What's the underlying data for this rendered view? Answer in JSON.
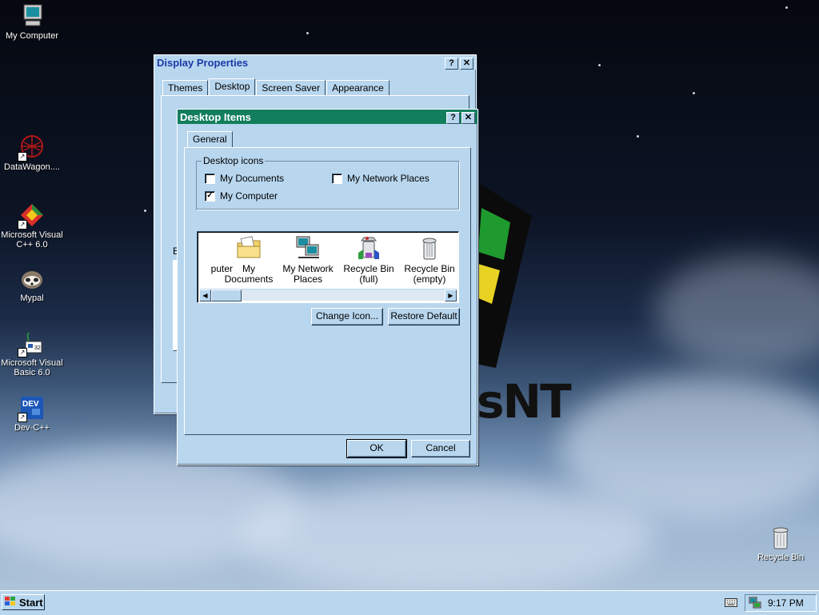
{
  "desktop": {
    "icons": [
      {
        "label": "My Computer",
        "icon": "my-computer-icon"
      },
      {
        "label": "DataWagon....",
        "icon": "datawagon-icon"
      },
      {
        "label": "Microsoft Visual C++ 6.0",
        "icon": "visual-cpp-icon"
      },
      {
        "label": "Mypal",
        "icon": "mypal-icon"
      },
      {
        "label": "Microsoft Visual Basic 6.0",
        "icon": "visual-basic-icon"
      },
      {
        "label": "Dev-C++",
        "icon": "devcpp-icon"
      },
      {
        "label": "Recycle Bin",
        "icon": "recycle-bin-icon"
      }
    ],
    "logo_text": "sNT"
  },
  "display_properties": {
    "title": "Display Properties",
    "help_glyph": "?",
    "close_glyph": "✕",
    "tabs": [
      "Themes",
      "Desktop",
      "Screen Saver",
      "Appearance"
    ],
    "active_tab": "Desktop",
    "partial_label": "B"
  },
  "desktop_items": {
    "title": "Desktop Items",
    "help_glyph": "?",
    "close_glyph": "✕",
    "tab": "General",
    "group_label": "Desktop icons",
    "checkboxes": [
      {
        "label": "My Documents",
        "checked": false
      },
      {
        "label": "My Network Places",
        "checked": false
      },
      {
        "label": "My Computer",
        "checked": true
      }
    ],
    "check_glyph": "✓",
    "list_items": [
      {
        "label": "puter",
        "icon": "my-computer-icon"
      },
      {
        "label": "My Documents",
        "icon": "my-documents-icon"
      },
      {
        "label": "My Network Places",
        "icon": "my-network-places-icon"
      },
      {
        "label": "Recycle Bin (full)",
        "icon": "recycle-bin-full-icon"
      },
      {
        "label": "Recycle Bin (empty)",
        "icon": "recycle-bin-empty-icon"
      }
    ],
    "scroll_left": "◀",
    "scroll_right": "▶",
    "change_icon_label": "Change Icon...",
    "restore_default_label": "Restore Default",
    "ok_label": "OK",
    "cancel_label": "Cancel"
  },
  "taskbar": {
    "start_label": "Start",
    "clock": "9:17 PM"
  }
}
